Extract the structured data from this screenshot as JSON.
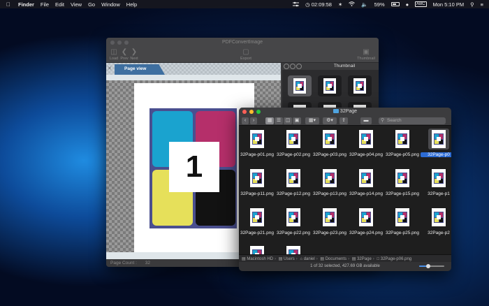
{
  "menubar": {
    "apple_icon": "apple-logo-icon",
    "app_name": "Finder",
    "items": [
      "File",
      "Edit",
      "View",
      "Go",
      "Window",
      "Help"
    ],
    "timer": "02:09:58",
    "battery_pct": "59%",
    "input_source": "ABC",
    "clock": "Mon 5:10 PM"
  },
  "pdf_window": {
    "title": "PDFConvertImage",
    "toolbar": {
      "load": "Load",
      "prev": "Prev",
      "next": "Next",
      "export": "Export",
      "thumbnail": "Thumbnail"
    },
    "tab_label": "Page view",
    "page_number": "1",
    "page_count_label": "Page Count :",
    "page_count_value": "32",
    "thumbnail_title": "Thumbnail"
  },
  "finder": {
    "title": "32Page",
    "search_placeholder": "Search",
    "files": [
      "32Page-p01.png",
      "32Page-p02.png",
      "32Page-p03.png",
      "32Page-p04.png",
      "32Page-p05.png",
      "32Page-p0",
      "32Page-p11.png",
      "32Page-p12.png",
      "32Page-p13.png",
      "32Page-p14.png",
      "32Page-p15.png",
      "32Page-p1",
      "32Page-p21.png",
      "32Page-p22.png",
      "32Page-p23.png",
      "32Page-p24.png",
      "32Page-p25.png",
      "32Page-p2"
    ],
    "selected_label": "32Page-p0",
    "path": [
      "Macintosh HD",
      "Users",
      "daniel",
      "Documents",
      "32Page",
      "32Page-p06.png"
    ],
    "status": "1 of 32 selected, 427.69 GB available",
    "icon_size_level": 0.35
  },
  "colors": {
    "cyan": "#1aa3cf",
    "magenta": "#b52f6a",
    "yellow": "#e6e05a",
    "black": "#121212",
    "selection": "#2c6bd3",
    "tab": "#3e6fa0"
  }
}
